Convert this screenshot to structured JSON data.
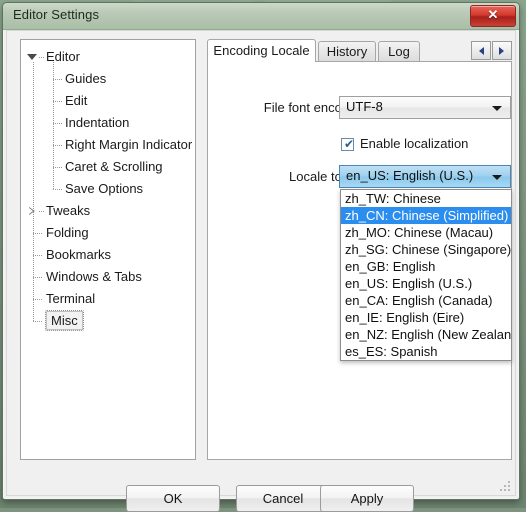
{
  "window": {
    "title": "Editor Settings",
    "close_label": "✕"
  },
  "tree": {
    "items": [
      {
        "label": "Editor",
        "level": 0,
        "twisty": "open",
        "selected": false
      },
      {
        "label": "Guides",
        "level": 1,
        "twisty": "none",
        "selected": false
      },
      {
        "label": "Edit",
        "level": 1,
        "twisty": "none",
        "selected": false
      },
      {
        "label": "Indentation",
        "level": 1,
        "twisty": "none",
        "selected": false
      },
      {
        "label": "Right Margin Indicator",
        "level": 1,
        "twisty": "none",
        "selected": false
      },
      {
        "label": "Caret & Scrolling",
        "level": 1,
        "twisty": "none",
        "selected": false
      },
      {
        "label": "Save Options",
        "level": 1,
        "twisty": "none",
        "selected": false
      },
      {
        "label": "Tweaks",
        "level": 0,
        "twisty": "closed",
        "selected": false
      },
      {
        "label": "Folding",
        "level": 0,
        "twisty": "none",
        "selected": false
      },
      {
        "label": "Bookmarks",
        "level": 0,
        "twisty": "none",
        "selected": false
      },
      {
        "label": "Windows & Tabs",
        "level": 0,
        "twisty": "none",
        "selected": false
      },
      {
        "label": "Terminal",
        "level": 0,
        "twisty": "none",
        "selected": false
      },
      {
        "label": "Misc",
        "level": 0,
        "twisty": "none",
        "selected": true
      }
    ]
  },
  "tabs": {
    "items": [
      {
        "label": "Encoding  Locale",
        "active": true
      },
      {
        "label": "History",
        "active": false
      },
      {
        "label": "Log",
        "active": false
      }
    ],
    "scroll_left": "◀",
    "scroll_right": "▶"
  },
  "form": {
    "encoding_label": "File font encoding:",
    "encoding_value": "UTF-8",
    "enable_localization_label": "Enable localization",
    "enable_localization_checked": true,
    "checkmark": "✔",
    "locale_label": "Locale to use:",
    "locale_value": "en_US: English (U.S.)"
  },
  "dropdown": {
    "selected_index": 1,
    "options": [
      "zh_TW: Chinese",
      "zh_CN: Chinese (Simplified)",
      "zh_MO: Chinese (Macau)",
      "zh_SG: Chinese (Singapore)",
      "en_GB: English",
      "en_US: English (U.S.)",
      "en_CA: English (Canada)",
      "en_IE: English (Eire)",
      "en_NZ: English (New Zealand)",
      "es_ES: Spanish"
    ]
  },
  "footer": {
    "ok": "OK",
    "cancel": "Cancel",
    "apply": "Apply"
  },
  "colors": {
    "titlebar": "#b9c9b6",
    "desktop": "#7e9480",
    "highlight": "#2b8ded",
    "combo_focus": "#9ed1ef",
    "close": "#d23a2d"
  }
}
